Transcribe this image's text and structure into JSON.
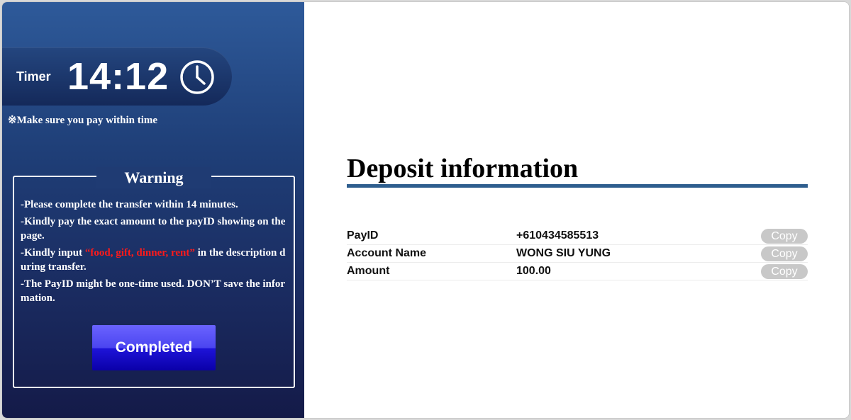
{
  "timer": {
    "label": "Timer",
    "value": "14:12",
    "note": "※Make sure you pay within time"
  },
  "warning": {
    "title": "Warning",
    "line1": "-Please complete the transfer within 14 minutes.",
    "line2": "-Kindly pay the exact amount to the payID showing on the page.",
    "line3_before": "-Kindly input ",
    "line3_highlight": "“food, gift, dinner, rent”",
    "line3_after": " in the description during transfer.",
    "line4": "-The PayID might be one-time used. DON’T save the information."
  },
  "completed_label": "Completed",
  "deposit": {
    "title": "Deposit information",
    "rows": [
      {
        "label": "PayID",
        "value": "+610434585513",
        "copy": "Copy"
      },
      {
        "label": "Account Name",
        "value": "WONG SIU YUNG",
        "copy": "Copy"
      },
      {
        "label": "Amount",
        "value": "100.00",
        "copy": "Copy"
      }
    ]
  },
  "colors": {
    "accent_rule": "#2e5e8e",
    "highlight_text": "#ff1a1a",
    "button_blue": "#1e13d8",
    "copy_button_gray": "#c8c8c8"
  },
  "icons": {
    "timer": "clock-icon"
  }
}
